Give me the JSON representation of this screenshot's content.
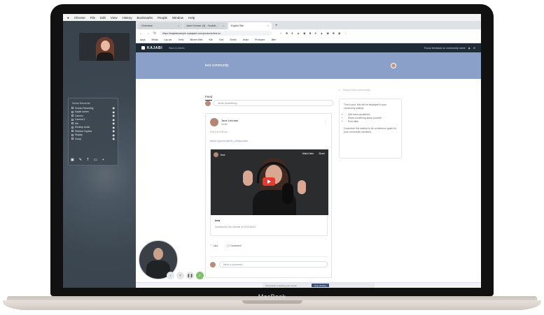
{
  "mac_menu": [
    "Chrome",
    "File",
    "Edit",
    "View",
    "History",
    "Bookmarks",
    "People",
    "Window",
    "Help"
  ],
  "browser": {
    "tabs": [
      {
        "title": "Overview"
      },
      {
        "title": "Jane Kenner (4) - Youtub..."
      },
      {
        "title": "Kajabi Site",
        "active": true
      }
    ],
    "url": "https://kajabiexample.mykajabi.com/products/test-st...",
    "bookmarks": [
      "Apps",
      "Media",
      "Lay prs",
      "Trello",
      "Blumer Web",
      "Kiln",
      "Grid",
      "Scribd",
      "Amaz",
      "Photopea",
      "Jitter"
    ]
  },
  "kajabi": {
    "logo": "KAJABI",
    "sub_label": "Back to Admin",
    "right_text": "Focus feedback on community name"
  },
  "community": {
    "title": "test community",
    "feed_tab": "Feed",
    "composer_placeholder": "Write something...",
    "search_placeholder": "Search this community...",
    "guide": {
      "intro": "This is your, this will be displayed in your community sidebar.",
      "items": [
        "Add some guidelines",
        "Share something about yourself",
        "Post often"
      ],
      "outro": "Customize this sidebar to be a reference guide for your community members."
    }
  },
  "post": {
    "author": "Jane Lehman",
    "role": "Admin",
    "date": "Feb 4 at 9:45 am",
    "link": "https://youtu.be/Dr_cN4pum0s",
    "video": {
      "channel": "test",
      "watch_later": "Watch later",
      "share": "Share",
      "title": "test",
      "uploaded": "Uploaded by Jan Lehman on 2019-08-04"
    },
    "like_label": "Like",
    "comment_label": "Comment",
    "comment_placeholder": "Write a comment..."
  },
  "layers_panel": {
    "title": "Scene Elements",
    "rows": [
      "Screen Recording",
      "Kajabi screen",
      "Camera",
      "Camera 2",
      "Mic",
      "Desktop Audio",
      "Window Capture",
      "Display",
      "Group"
    ]
  },
  "notification": {
    "text": "Screencast is sharing your screen.",
    "button": "Stop sharing"
  },
  "device_label": "MacBook"
}
